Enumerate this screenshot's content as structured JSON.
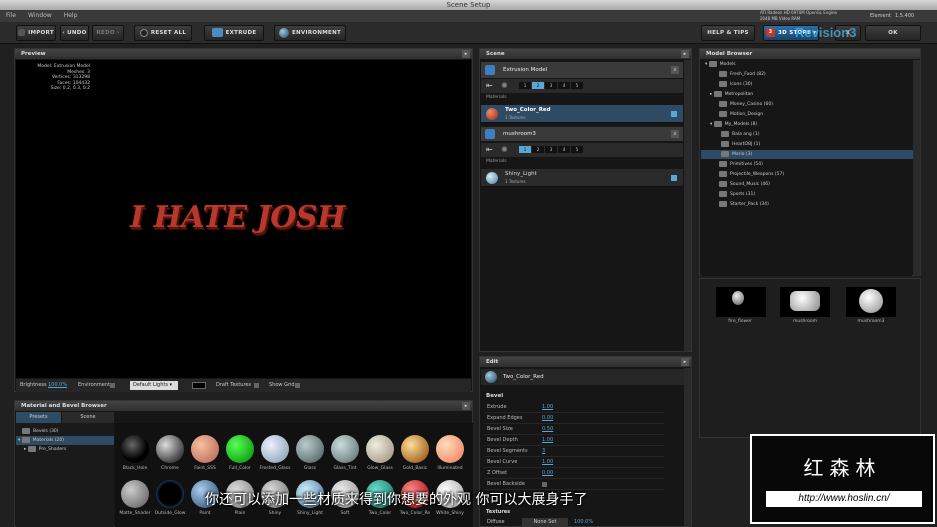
{
  "window": {
    "title": "Scene Setup"
  },
  "menu": [
    "File",
    "Window",
    "Help"
  ],
  "gpu": {
    "line1": "ATI Radeon HD 6970M OpenGL Engine",
    "line2": "2048 MB Video RAM",
    "element_label": "Element",
    "version": "1.5.400"
  },
  "toolbar": {
    "import": "IMPORT",
    "undo": "UNDO",
    "redo": "REDO",
    "reset_all": "RESET ALL",
    "extrude": "EXTRUDE",
    "environment": "ENVIRONMENT",
    "help_tips": "HELP & TIPS",
    "store_badge": "3",
    "store": "3D STORE",
    "close": "X",
    "ok": "OK"
  },
  "watermark": "Revision3",
  "preview": {
    "title": "Preview",
    "info": [
      "Model: Extrusion Model",
      "Meshes: 3",
      "Vertices: 313298",
      "Faces: 104432",
      "Size: 0.2, 0.3, 0.2"
    ],
    "text": "I HATE JOSH"
  },
  "preview_bar": {
    "brightness_label": "Brightness",
    "brightness_value": "100.0%",
    "environment_label": "Environment",
    "lights_value": "Default Lights",
    "draft_label": "Draft Textures",
    "grid_label": "Show Grid"
  },
  "scene": {
    "title": "Scene",
    "model1": {
      "name": "Extrusion Model",
      "tabs": [
        "1",
        "2",
        "3",
        "4",
        "5"
      ],
      "materials_label": "Materials",
      "material": {
        "name": "Two_Color_Red",
        "sub": "1 Textures"
      }
    },
    "model2": {
      "name": "mushroom3",
      "tabs": [
        "1",
        "2",
        "3",
        "4",
        "5"
      ],
      "materials_label": "Materials",
      "material": {
        "name": "Shiny_Light",
        "sub": "1 Textures"
      }
    }
  },
  "edit": {
    "title": "Edit",
    "material": "Two_Color_Red",
    "section": "Bevel",
    "rows": [
      {
        "label": "Extrude",
        "value": "1.00"
      },
      {
        "label": "Expand Edges",
        "value": "0.00"
      },
      {
        "label": "Bevel Size",
        "value": "0.50"
      },
      {
        "label": "Bevel Depth",
        "value": "1.00"
      },
      {
        "label": "Bevel Segments",
        "value": "3"
      },
      {
        "label": "Bevel Curve",
        "value": "1.00"
      },
      {
        "label": "Z Offset",
        "value": "0.00"
      },
      {
        "label": "Bevel Backside",
        "value": ""
      }
    ],
    "textures_label": "Textures",
    "diffuse_label": "Diffuse",
    "diffuse_value": "None Set",
    "diffuse_pct": "100.0%"
  },
  "browser": {
    "title": "Material and Bevel Browser",
    "tabs": [
      "Presets",
      "Scene"
    ],
    "tree": [
      "Bevels (30)",
      "Materials (20)",
      "Pre_Shaders"
    ],
    "row1": [
      "Black_Hole",
      "Chrome",
      "Faint_SSS",
      "Full_Color",
      "Frosted_Glass",
      "Glass",
      "Glass_Tint",
      "Glow_Glass",
      "Gold_Basic",
      "Illuminated"
    ],
    "row2": [
      "Matte_Shader",
      "Outside_Glow",
      "Paint",
      "Plain",
      "Shiny",
      "Shiny_Light",
      "Soft",
      "Two_Color",
      "Two_Color_Re",
      "White_Shiny"
    ]
  },
  "model_browser": {
    "title": "Model Browser",
    "root": "Models",
    "items": [
      "Fresh_Food (82)",
      "Icons (30)",
      "Metropolitan",
      "Money_Casino (60)",
      "Motion_Design",
      "My_Models (8)",
      "Bala ang (1)",
      "HeartOBJ (1)",
      "Mario (3)",
      "Primitives (54)",
      "Projectile_Weapons (57)",
      "Sound_Music (46)",
      "Sports (31)",
      "Starter_Pack (34)"
    ],
    "thumbs": [
      "fire_flower",
      "mushroom",
      "mushroom3"
    ]
  },
  "overlay": {
    "subtitle": "你还可以添加一些材质来得到你想要的外观 你可以大展身手了",
    "brand": "红森林",
    "url": "http://www.hoslin.cn/"
  },
  "colors": {
    "accent": "#5aa6d6",
    "titleRed": "#c0392b"
  }
}
